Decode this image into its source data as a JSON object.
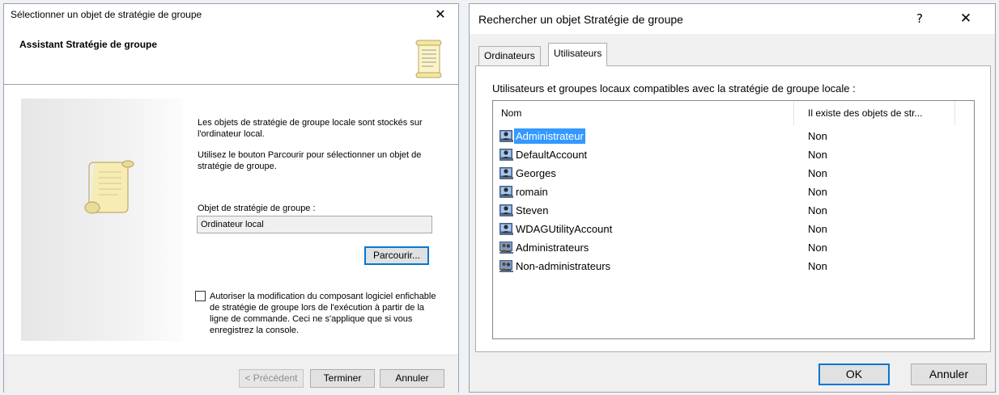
{
  "wizard": {
    "title": "Sélectionner un objet de stratégie de groupe",
    "header_title": "Assistant Stratégie de groupe",
    "para1": "Les objets de stratégie de groupe locale sont stockés sur l'ordinateur local.",
    "para2": "Utilisez le bouton Parcourir pour sélectionner un objet de stratégie de groupe.",
    "gpo_label": "Objet de stratégie de groupe :",
    "gpo_value": "Ordinateur local",
    "browse_label": "Parcourir...",
    "checkbox_label": "Autoriser la modification du composant logiciel enfichable de stratégie de groupe lors de l'exécution à partir de la ligne de commande. Ceci ne s'applique que si vous enregistrez la console.",
    "checkbox_checked": false,
    "prev_label": "< Précédent",
    "finish_label": "Terminer",
    "cancel_label": "Annuler"
  },
  "search": {
    "title": "Rechercher un objet Stratégie de groupe",
    "help_label": "?",
    "tabs": [
      {
        "label": "Ordinateurs",
        "active": false
      },
      {
        "label": "Utilisateurs",
        "active": true
      }
    ],
    "list_caption": "Utilisateurs et groupes locaux compatibles avec la stratégie de groupe locale :",
    "columns": [
      "Nom",
      "Il existe des objets de str..."
    ],
    "rows": [
      {
        "name": "Administrateur",
        "exists": "Non",
        "kind": "user",
        "selected": true
      },
      {
        "name": "DefaultAccount",
        "exists": "Non",
        "kind": "user",
        "selected": false
      },
      {
        "name": "Georges",
        "exists": "Non",
        "kind": "user",
        "selected": false
      },
      {
        "name": "romain",
        "exists": "Non",
        "kind": "user",
        "selected": false
      },
      {
        "name": "Steven",
        "exists": "Non",
        "kind": "user",
        "selected": false
      },
      {
        "name": "WDAGUtilityAccount",
        "exists": "Non",
        "kind": "user",
        "selected": false
      },
      {
        "name": "Administrateurs",
        "exists": "Non",
        "kind": "group",
        "selected": false
      },
      {
        "name": "Non-administrateurs",
        "exists": "Non",
        "kind": "group",
        "selected": false
      }
    ],
    "ok_label": "OK",
    "cancel_label": "Annuler"
  },
  "icons": {
    "close": "close-icon",
    "help": "help-icon",
    "scroll": "scroll-icon",
    "user": "user-icon",
    "group": "group-icon"
  },
  "colors": {
    "selection": "#3399ff",
    "accent_border": "#0078d7"
  }
}
